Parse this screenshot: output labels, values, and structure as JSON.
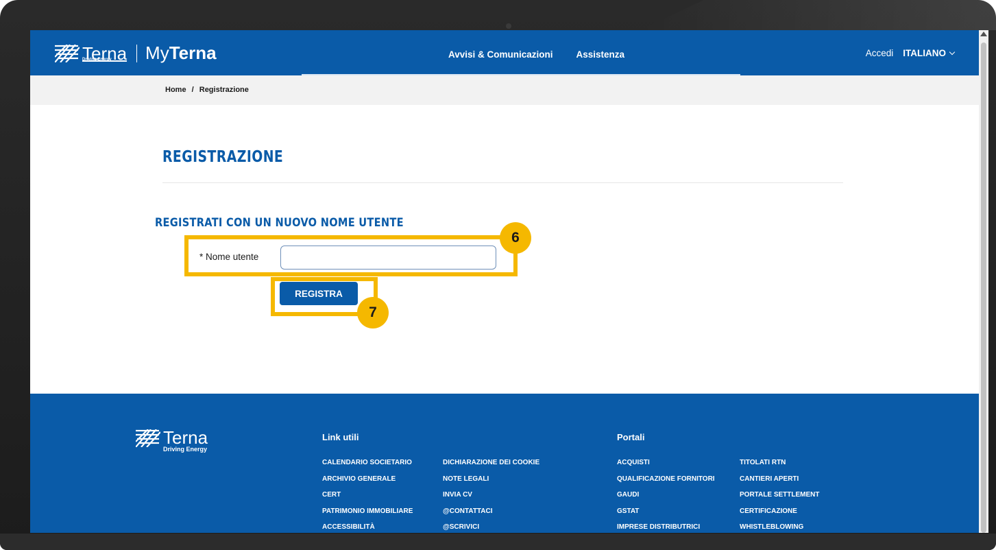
{
  "header": {
    "logo_text": "Terna",
    "logo_tagline": "Driving Energy",
    "brand_prefix": "My",
    "brand_suffix": "Terna",
    "nav": [
      "Avvisi & Comunicazioni",
      "Assistenza"
    ],
    "login_label": "Accedi",
    "language": "ITALIANO"
  },
  "breadcrumb": {
    "home": "Home",
    "separator": "/",
    "current": "Registrazione"
  },
  "main": {
    "page_title": "REGISTRAZIONE",
    "section_title": "REGISTRATI CON UN NUOVO NOME UTENTE",
    "username_label": "* Nome utente",
    "username_value": "",
    "register_button": "REGISTRA"
  },
  "annotations": {
    "step_field": "6",
    "step_button": "7",
    "highlight_color": "#f5b800"
  },
  "footer": {
    "logo_text": "Terna",
    "logo_tagline": "Driving Energy",
    "link_utili_title": "Link utili",
    "link_utili_col1": [
      "CALENDARIO SOCIETARIO",
      "ARCHIVIO GENERALE",
      "CERT",
      "PATRIMONIO IMMOBILIARE",
      "ACCESSIBILITÀ"
    ],
    "link_utili_col2": [
      "DICHIARAZIONE DEI COOKIE",
      "NOTE LEGALI",
      "INVIA CV",
      "@CONTATTACI",
      "@SCRIVICI"
    ],
    "portali_title": "Portali",
    "portali_col1": [
      "ACQUISTI",
      "QUALIFICAZIONE FORNITORI",
      "GAUDI",
      "GSTAT",
      "IMPRESE DISTRIBUTRICI"
    ],
    "portali_col2": [
      "TITOLATI RTN",
      "CANTIERI APERTI",
      "PORTALE SETTLEMENT",
      "CERTIFICAZIONE",
      "WHISTLEBLOWING"
    ]
  },
  "colors": {
    "brand_blue": "#0a5ba8",
    "accent_yellow": "#f5b800"
  }
}
